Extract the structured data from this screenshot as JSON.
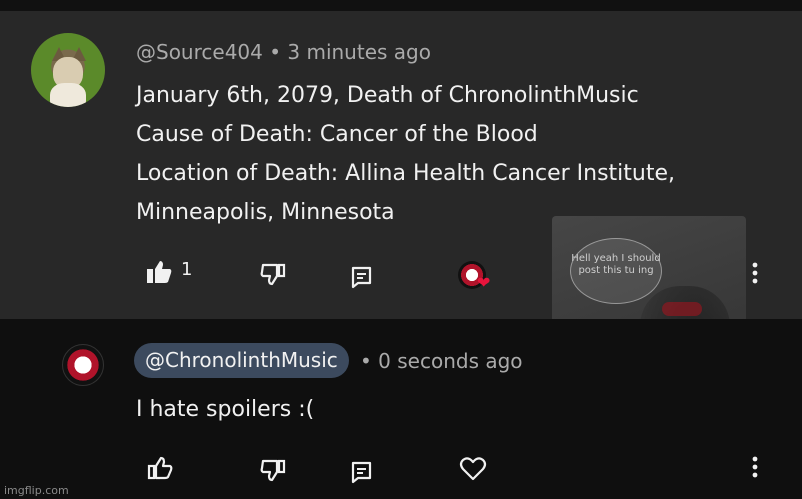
{
  "comment": {
    "handle": "@Source404",
    "time": "• 3 minutes ago",
    "lines": [
      "January 6th, 2079, Death of ChronolinthMusic",
      "Cause of Death: Cancer of the Blood",
      "Location of Death: Allina Health Cancer Institute,",
      "Minneapolis, Minnesota"
    ],
    "like_count": "1"
  },
  "reply": {
    "author_chip": "@ChronolinthMusic",
    "time": "• 0 seconds ago",
    "text": "I hate spoilers :("
  },
  "overlay": {
    "bubble_text": "Hell yeah I should post this tu ing"
  },
  "watermark": "imgflip.com",
  "colors": {
    "comment_bg": "#282828",
    "page_bg": "#0f0f0f",
    "chip_bg": "#3c4a5e",
    "heart": "#e8143c",
    "muted_text": "#aaaaaa"
  },
  "icons": [
    "thumbs-up-filled-icon",
    "thumbs-down-icon",
    "reply-icon",
    "more-vert-icon",
    "heart-icon",
    "thumbs-up-outline-icon"
  ]
}
